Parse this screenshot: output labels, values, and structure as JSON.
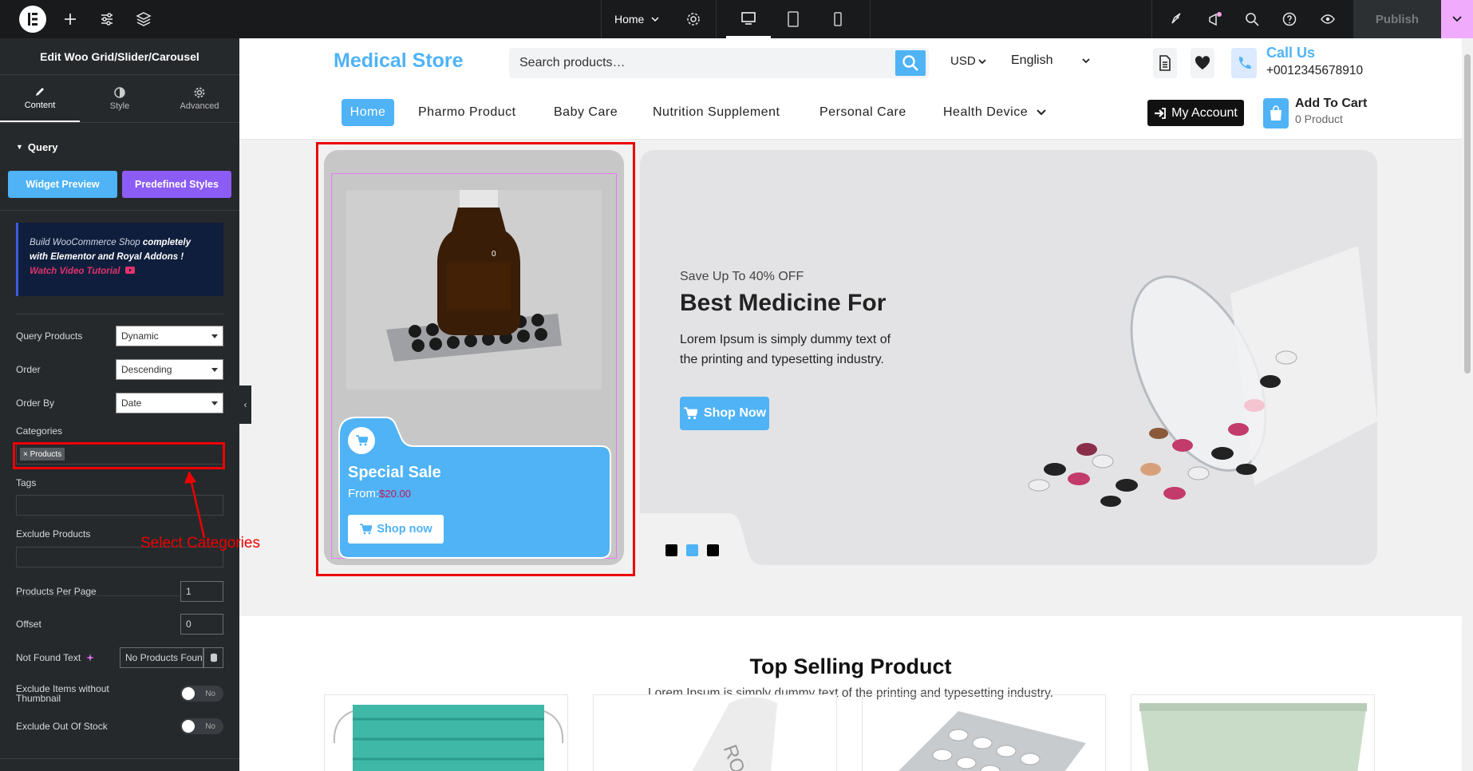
{
  "topbar": {
    "page_selector": "Home",
    "publish_label": "Publish"
  },
  "sidebar": {
    "title": "Edit Woo Grid/Slider/Carousel",
    "tabs": [
      {
        "label": "Content",
        "icon": "pencil-icon"
      },
      {
        "label": "Style",
        "icon": "contrast-icon"
      },
      {
        "label": "Advanced",
        "icon": "gear-icon"
      }
    ],
    "section_title": "Query",
    "widget_preview_label": "Widget Preview",
    "predefined_styles_label": "Predefined Styles",
    "promo": {
      "line1": "Build WooCommerce Shop ",
      "line1_bold": "completely",
      "line2_bold": "with Elementor and Royal Addons !",
      "watch": "Watch Video Tutorial"
    },
    "query_products": {
      "label": "Query Products",
      "value": "Dynamic"
    },
    "order": {
      "label": "Order",
      "value": "Descending"
    },
    "order_by": {
      "label": "Order By",
      "value": "Date"
    },
    "categories": {
      "label": "Categories",
      "chip": "× Products"
    },
    "tags": {
      "label": "Tags"
    },
    "exclude_products": {
      "label": "Exclude Products"
    },
    "products_per_page": {
      "label": "Products Per Page",
      "value": "1"
    },
    "offset": {
      "label": "Offset",
      "value": "0"
    },
    "not_found_text": {
      "label": "Not Found Text",
      "value": "No Products Foun"
    },
    "exclude_without_thumb": {
      "label": "Exclude Items without Thumbnail",
      "value": "No"
    },
    "exclude_out_of_stock": {
      "label": "Exclude Out Of Stock",
      "value": "No"
    }
  },
  "annotation": {
    "label": "Select Categories"
  },
  "site": {
    "logo": "Medical Store",
    "search_placeholder": "Search products…",
    "currency": "USD",
    "language": "English",
    "call_us": "Call Us",
    "phone": "+0012345678910",
    "nav": [
      "Home",
      "Pharmo Product",
      "Baby Care",
      "Nutrition Supplement",
      "Personal Care",
      "Health Device"
    ],
    "my_account": "My Account",
    "cart_title": "Add To Cart",
    "cart_count": "0 Product"
  },
  "product_card": {
    "title": "Special Sale",
    "price_prefix": "From:",
    "price": "$20.00",
    "button": "Shop now",
    "badge": "0"
  },
  "hero": {
    "kicker": "Save Up To 40% OFF",
    "heading": "Best Medicine For",
    "body": "Lorem Ipsum is simply dummy text of the printing and typesetting industry.",
    "button": "Shop Now"
  },
  "top_selling": {
    "heading": "Top Selling Product",
    "subheading": "Lorem Ipsum is simply dummy text of the printing and typesetting industry."
  },
  "colors": {
    "accent_blue": "#4fb3f6",
    "elementor_purple": "#9b5de5",
    "annotation_red": "#e00000"
  }
}
